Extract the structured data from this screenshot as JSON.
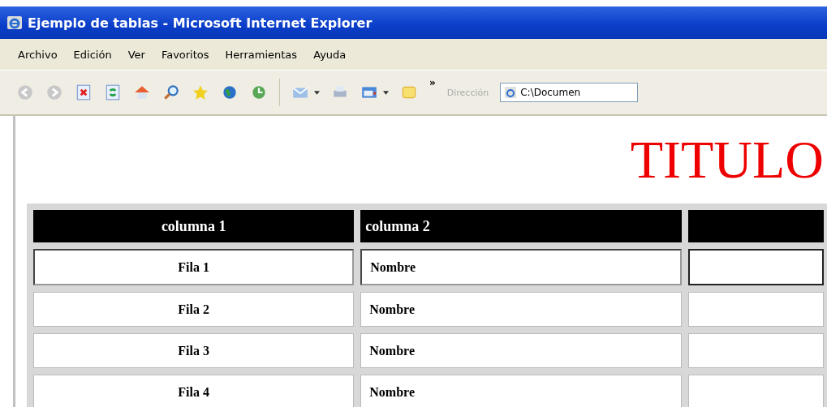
{
  "window": {
    "title": "Ejemplo de tablas - Microsoft Internet Explorer"
  },
  "menu": [
    "Archivo",
    "Edición",
    "Ver",
    "Favoritos",
    "Herramientas",
    "Ayuda"
  ],
  "toolbar": {
    "more": "»",
    "address_label": "Dirección",
    "address": "C:\\Documen"
  },
  "page": {
    "title": "TITULO",
    "table": {
      "columns": [
        "columna 1",
        "columna 2",
        ""
      ],
      "rows": [
        {
          "cells": [
            "Fila 1",
            "Nombre",
            ""
          ],
          "selected": true
        },
        {
          "cells": [
            "Fila 2",
            "Nombre",
            ""
          ],
          "selected": false
        },
        {
          "cells": [
            "Fila 3",
            "Nombre",
            ""
          ],
          "selected": false
        },
        {
          "cells": [
            "Fila 4",
            "Nombre",
            ""
          ],
          "selected": false
        }
      ]
    }
  }
}
